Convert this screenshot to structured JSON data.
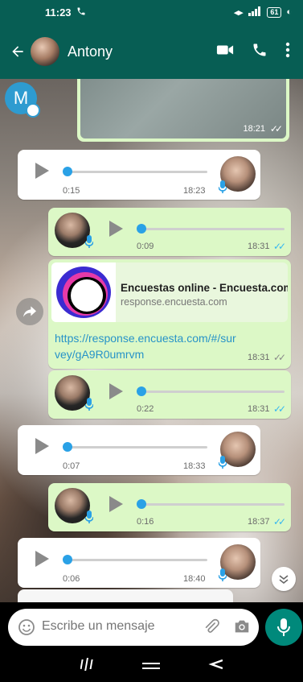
{
  "status_bar": {
    "time": "11:23",
    "battery": "61"
  },
  "header": {
    "contact_name": "Antony"
  },
  "messages": {
    "image_time": "18:21",
    "voice1": {
      "duration": "0:15",
      "time": "18:23"
    },
    "voice2": {
      "duration": "0:09",
      "time": "18:31"
    },
    "link": {
      "title": "Encuestas online - Encuesta.com",
      "domain": "response.encuesta.com",
      "url": "https://response.encuesta.com/#/survey/gA9R0umrvm",
      "time": "18:31"
    },
    "voice3": {
      "duration": "0:22",
      "time": "18:31"
    },
    "voice4": {
      "duration": "0:07",
      "time": "18:33"
    },
    "voice5": {
      "duration": "0:16",
      "time": "18:37"
    },
    "voice6": {
      "duration": "0:06",
      "time": "18:40"
    }
  },
  "composer": {
    "placeholder": "Escribe un mensaje"
  },
  "contact_avatar_letter": "M",
  "colors": {
    "header": "#075e54",
    "outgoing": "#dcf8c6",
    "fab": "#00897b",
    "read_ticks": "#34b7f1"
  }
}
